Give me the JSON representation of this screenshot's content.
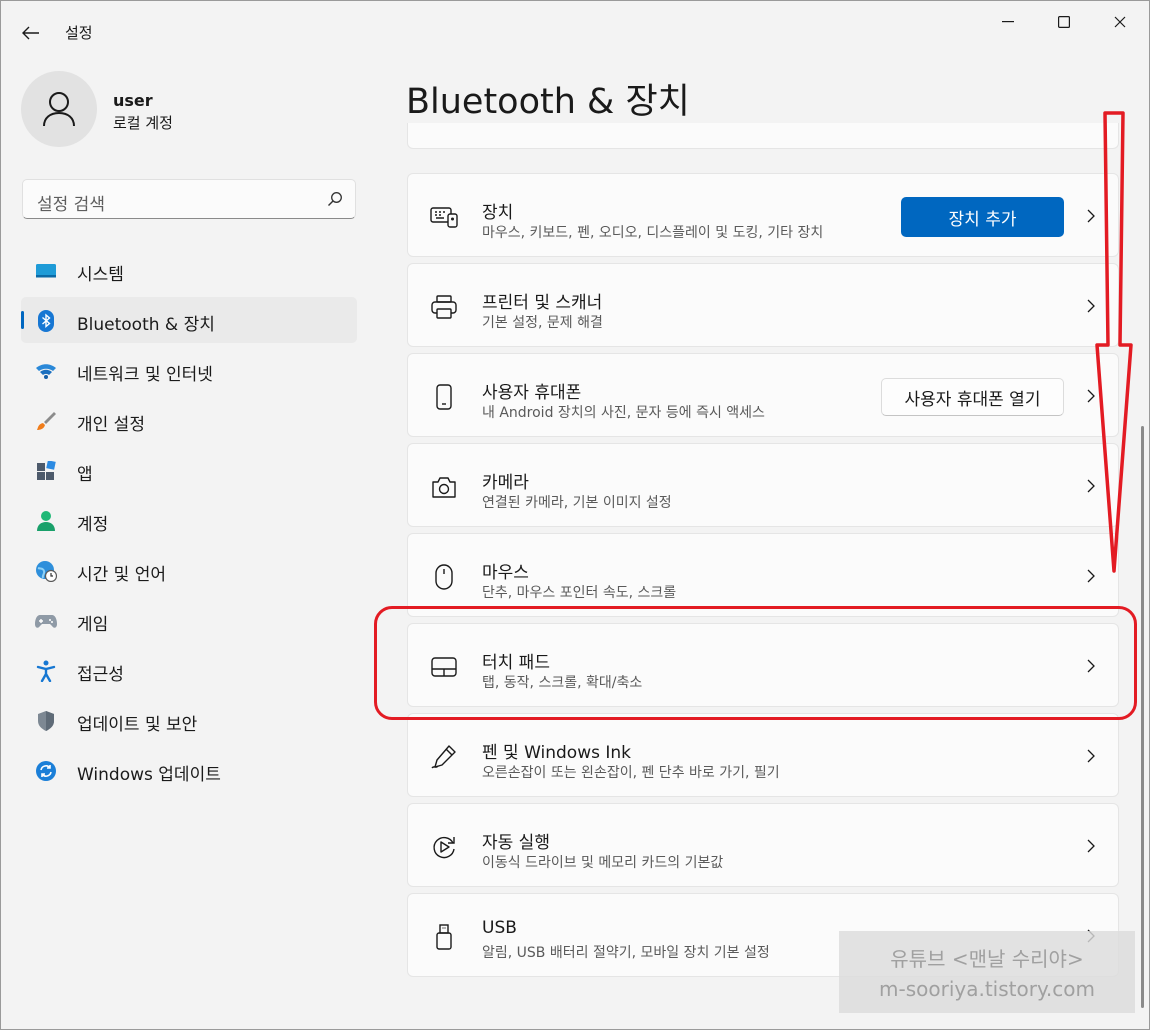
{
  "window": {
    "app_title": "설정"
  },
  "profile": {
    "name": "user",
    "account_type": "로컬 계정"
  },
  "search": {
    "placeholder": "설정 검색"
  },
  "sidebar": {
    "items": [
      {
        "label": "시스템",
        "icon": "monitor-icon"
      },
      {
        "label": "Bluetooth & 장치",
        "icon": "bluetooth-icon",
        "active": true
      },
      {
        "label": "네트워크 및 인터넷",
        "icon": "wifi-icon"
      },
      {
        "label": "개인 설정",
        "icon": "brush-icon"
      },
      {
        "label": "앱",
        "icon": "apps-icon"
      },
      {
        "label": "계정",
        "icon": "person-icon"
      },
      {
        "label": "시간 및 언어",
        "icon": "globe-clock-icon"
      },
      {
        "label": "게임",
        "icon": "gamepad-icon"
      },
      {
        "label": "접근성",
        "icon": "accessibility-icon"
      },
      {
        "label": "업데이트 및 보안",
        "icon": "shield-icon"
      },
      {
        "label": "Windows 업데이트",
        "icon": "sync-icon"
      }
    ]
  },
  "main": {
    "title": "Bluetooth & 장치",
    "cards": [
      {
        "title": "장치",
        "desc": "마우스, 키보드, 펜, 오디오, 디스플레이 및 도킹, 기타 장치",
        "icon": "devices-icon",
        "button": "장치 추가"
      },
      {
        "title": "프린터 및 스캐너",
        "desc": "기본 설정, 문제 해결",
        "icon": "printer-icon"
      },
      {
        "title": "사용자 휴대폰",
        "desc": "내 Android 장치의 사진, 문자 등에 즉시 액세스",
        "icon": "phone-icon",
        "button": "사용자 휴대폰 열기"
      },
      {
        "title": "카메라",
        "desc": "연결된 카메라, 기본 이미지 설정",
        "icon": "camera-icon"
      },
      {
        "title": "마우스",
        "desc": "단추, 마우스 포인터 속도, 스크롤",
        "icon": "mouse-icon"
      },
      {
        "title": "터치 패드",
        "desc": "탭, 동작, 스크롤, 확대/축소",
        "icon": "touchpad-icon"
      },
      {
        "title": "펜 및 Windows Ink",
        "desc": "오른손잡이 또는 왼손잡이, 펜 단추 바로 가기, 필기",
        "icon": "pen-icon"
      },
      {
        "title": "자동 실행",
        "desc": "이동식 드라이브 및 메모리 카드의 기본값",
        "icon": "autoplay-icon"
      },
      {
        "title": "USB",
        "desc": "알림, USB 배터리 절약기, 모바일 장치 기본 설정",
        "icon": "usb-icon"
      }
    ]
  },
  "watermark": {
    "line1": "유튜브 <맨날 수리야>",
    "line2": "m-sooriya.tistory.com"
  },
  "colors": {
    "accent": "#0067c0",
    "annotation": "#e31b23"
  }
}
